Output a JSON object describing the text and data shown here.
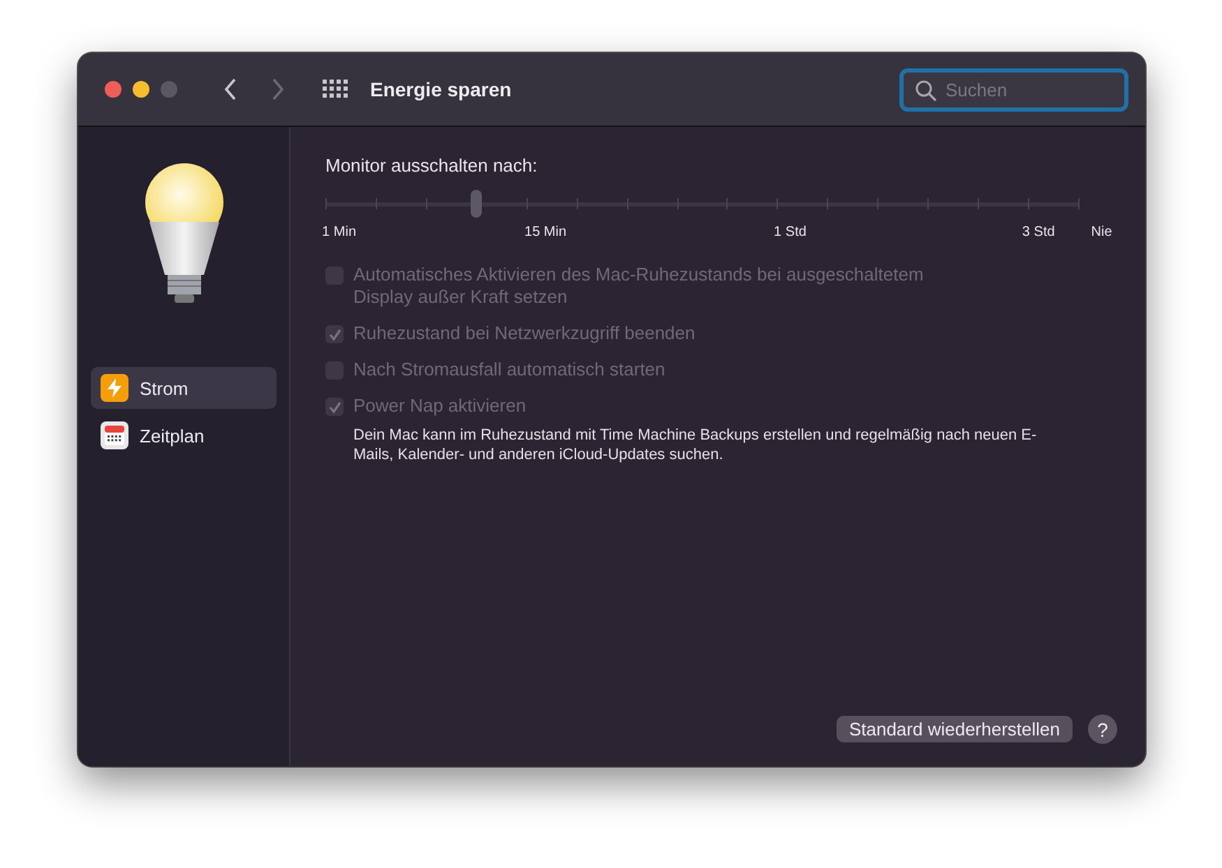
{
  "window": {
    "title": "Energie sparen"
  },
  "search": {
    "placeholder": "Suchen"
  },
  "sidebar": {
    "items": [
      {
        "label": "Strom",
        "kind": "power",
        "selected": true
      },
      {
        "label": "Zeitplan",
        "kind": "calendar",
        "selected": false
      }
    ]
  },
  "monitor_slider": {
    "label": "Monitor ausschalten nach:",
    "level": 0.2,
    "ticks": [
      "1 Min",
      "15 Min",
      "1 Std",
      "3 Std",
      "Nie"
    ]
  },
  "options": [
    {
      "label": "Automatisches Aktivieren des Mac-Ruhezustands bei ausgeschaltetem Display außer Kraft setzen",
      "checked": false,
      "disabled": true
    },
    {
      "label": "Ruhezustand bei Netzwerkzugriff beenden",
      "checked": true,
      "disabled": true
    },
    {
      "label": "Nach Stromausfall automatisch starten",
      "checked": false,
      "disabled": true
    },
    {
      "label": "Power Nap aktivieren",
      "checked": true,
      "disabled": true,
      "note": "Dein Mac kann im Ruhezustand mit Time Machine Backups erstellen und regelmäßig nach neuen E-Mails, Kalender- und anderen iCloud-Updates suchen."
    }
  ],
  "buttons": {
    "restore": "Standard wiederherstellen",
    "help": "?"
  }
}
